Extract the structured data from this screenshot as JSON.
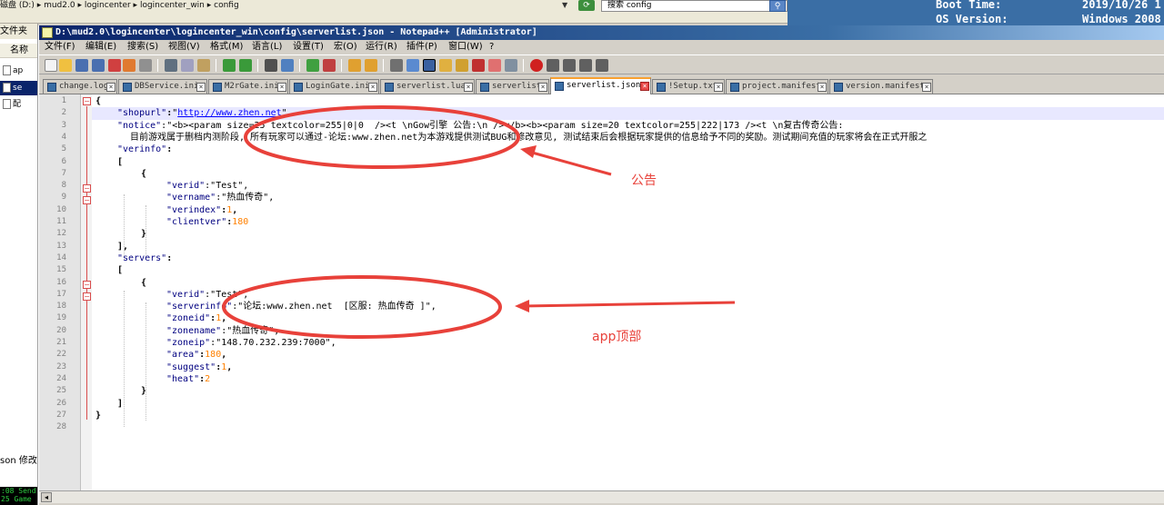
{
  "explorer": {
    "path": "磁盘 (D:) ▸ mud2.0 ▸ logincenter ▸ logincenter_win ▸ config",
    "search_placeholder": "搜索 config",
    "sidebar_title": "文件夹",
    "column_header": "名称",
    "rows": [
      "ap",
      "se",
      "配"
    ],
    "status_text": "son 修改",
    "console_lines": [
      ":08 Send",
      "25 Game"
    ]
  },
  "sysinfo": {
    "boot_time_label": "Boot Time:",
    "boot_time_value": "2019/10/26 1",
    "os_version_label": "OS Version:",
    "os_version_value": "Windows 2008"
  },
  "window": {
    "title": "D:\\mud2.0\\logincenter\\logincenter_win\\config\\serverlist.json - Notepad++ [Administrator]"
  },
  "menu": [
    "文件(F)",
    "编辑(E)",
    "搜索(S)",
    "视图(V)",
    "格式(M)",
    "语言(L)",
    "设置(T)",
    "宏(O)",
    "运行(R)",
    "插件(P)",
    "窗口(W)",
    "?"
  ],
  "tabs": [
    {
      "label": "change.log"
    },
    {
      "label": "DBService.ini"
    },
    {
      "label": "M2rGate.ini"
    },
    {
      "label": "LoginGate.ini"
    },
    {
      "label": "serverlist.lua"
    },
    {
      "label": "serverlist"
    },
    {
      "label": "serverlist.json",
      "active": true
    },
    {
      "label": "!Setup.txt"
    },
    {
      "label": "project.manifest"
    },
    {
      "label": "version.manifest"
    }
  ],
  "line_numbers": [
    "1",
    "2",
    "3",
    "4",
    "5",
    "6",
    "7",
    "8",
    "9",
    "10",
    "11",
    "12",
    "13",
    "14",
    "15",
    "16",
    "17",
    "18",
    "19",
    "20",
    "21",
    "22",
    "23",
    "24",
    "25",
    "26",
    "27",
    "28"
  ],
  "code": {
    "l1": "{",
    "l2_key": "\"shopurl\"",
    "l2_colon": ":",
    "l2_q1": "\"",
    "l2_url": "http://www.zhen.net",
    "l2_q2": "\",",
    "l3_key": "\"notice\"",
    "l3_val": ":\"<b><param size=25 textcolor=255|0|0  /><t \\nGow引擎 公告:\\n /></b><b><param size=20 textcolor=255|222|173 /><t \\n复古传奇公告:",
    "l4": "目前游戏属于删档内测阶段, 所有玩家可以通过-论坛:www.zhen.net为本游戏提供测试BUG和修改意见, 测试结束后会根据玩家提供的信息给予不同的奖励。测试期间充值的玩家将会在正式开服之",
    "l5_key": "\"verinfo\"",
    "l5_rest": ":",
    "l6": "[",
    "l7": "{",
    "l8_key": "\"verid\"",
    "l8_rest": ":\"Test\",",
    "l9_key": "\"vername\"",
    "l9_rest": ":\"热血传奇\",",
    "l10_key": "\"verindex\"",
    "l10_colon": ":",
    "l10_num": "1",
    "l10_comma": ",",
    "l11_key": "\"clientver\"",
    "l11_colon": ":",
    "l11_num": "180",
    "l12": "}",
    "l13": "],",
    "l14_key": "\"servers\"",
    "l14_rest": ":",
    "l15": "[",
    "l16": "{",
    "l17_key": "\"verid\"",
    "l17_rest": ":\"Test\",",
    "l18_key": "\"serverinfo\"",
    "l18_rest": ":\"论坛:www.zhen.net  [区服: 热血传奇 ]\",",
    "l19_key": "\"zoneid\"",
    "l19_colon": ":",
    "l19_num": "1",
    "l19_comma": ",",
    "l20_key": "\"zonename\"",
    "l20_rest": ":\"热血传奇\",",
    "l21_key": "\"zoneip\"",
    "l21_rest": ":\"148.70.232.239:7000\",",
    "l22_key": "\"area\"",
    "l22_colon": ":",
    "l22_num": "180",
    "l22_comma": ",",
    "l23_key": "\"suggest\"",
    "l23_colon": ":",
    "l23_num": "1",
    "l23_comma": ",",
    "l24_key": "\"heat\"",
    "l24_colon": ":",
    "l24_num": "2",
    "l25": "}",
    "l26": "]",
    "l27": "}"
  },
  "annotations": {
    "notice_label": "公告",
    "app_label": "app顶部",
    "color": "#e8413a"
  }
}
